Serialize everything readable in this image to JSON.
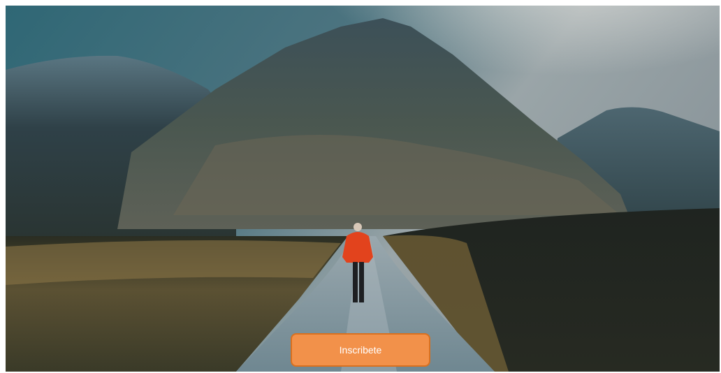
{
  "hero": {
    "image_name": "mountain-road-hiker",
    "button_label": "Inscribete",
    "button_color": "#f2914a",
    "button_border_color": "#d9701f",
    "button_text_color": "#ffffff"
  }
}
